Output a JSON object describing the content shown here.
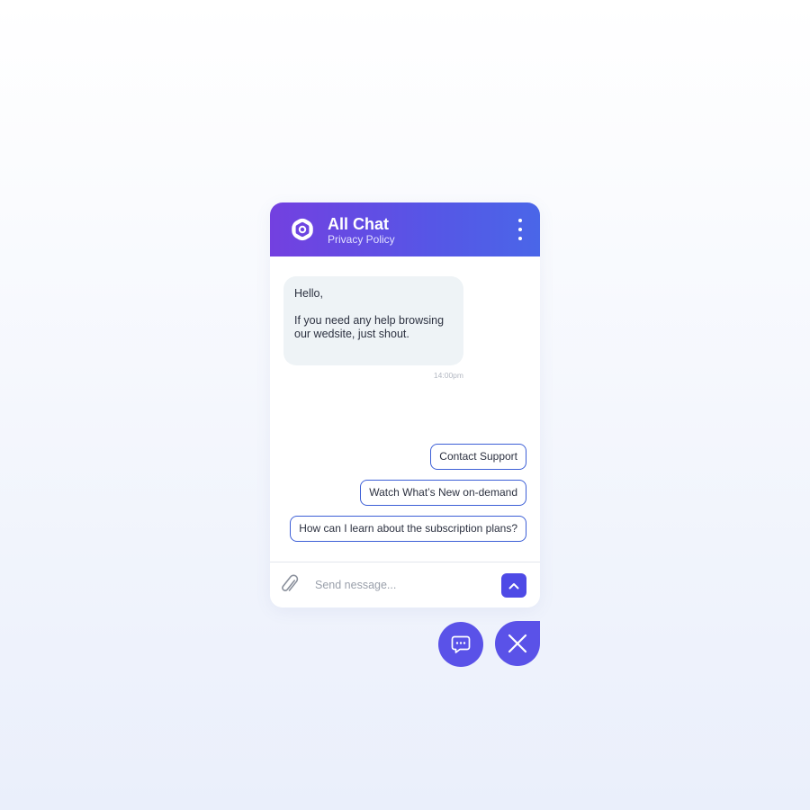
{
  "header": {
    "title": "All Chat",
    "subtitle": "Privacy Policy",
    "logo_icon": "openai-knot-logo",
    "menu_icon": "vertical-ellipsis-icon"
  },
  "messages": [
    {
      "from": "bot",
      "greeting": "Hello,",
      "text": "If you need any help browsing our wedsite, just shout.",
      "time": "14:00pm"
    }
  ],
  "suggestions": [
    {
      "label": "Contact Support"
    },
    {
      "label": "Watch What’s New on-demand"
    },
    {
      "label": "How can I learn about the subscription plans?"
    }
  ],
  "composer": {
    "placeholder": "Send nessage...",
    "attach_icon": "paperclip-icon",
    "send_icon": "chevron-up-icon"
  },
  "launchers": {
    "chat_icon": "chat-bubble-icon",
    "close_icon": "close-icon"
  },
  "colors": {
    "header_gradient_start": "#7340e0",
    "header_gradient_end": "#4a66e8",
    "accent": "#4e4ae6",
    "suggestion_border": "#3d5fd6",
    "bubble_bg": "#eef3f6"
  }
}
